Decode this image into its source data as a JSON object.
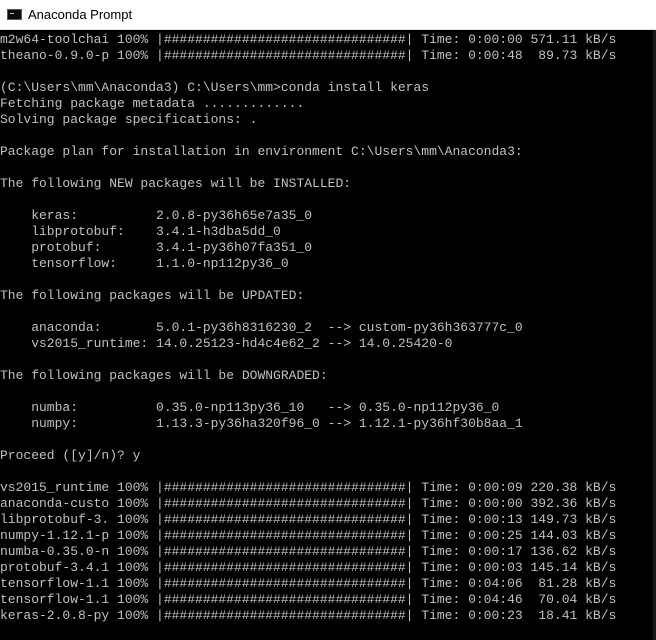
{
  "window": {
    "title": "Anaconda Prompt",
    "icon": "console-icon"
  },
  "console": {
    "lines": [
      "m2w64-toolchai 100% |###############################| Time: 0:00:00 571.11 kB/s",
      "theano-0.9.0-p 100% |###############################| Time: 0:00:48  89.73 kB/s",
      "",
      "(C:\\Users\\mm\\Anaconda3) C:\\Users\\mm>conda install keras",
      "Fetching package metadata .............",
      "Solving package specifications: .",
      "",
      "Package plan for installation in environment C:\\Users\\mm\\Anaconda3:",
      "",
      "The following NEW packages will be INSTALLED:",
      "",
      "    keras:          2.0.8-py36h65e7a35_0",
      "    libprotobuf:    3.4.1-h3dba5dd_0",
      "    protobuf:       3.4.1-py36h07fa351_0",
      "    tensorflow:     1.1.0-np112py36_0",
      "",
      "The following packages will be UPDATED:",
      "",
      "    anaconda:       5.0.1-py36h8316230_2  --> custom-py36h363777c_0",
      "    vs2015_runtime: 14.0.25123-hd4c4e62_2 --> 14.0.25420-0",
      "",
      "The following packages will be DOWNGRADED:",
      "",
      "    numba:          0.35.0-np113py36_10   --> 0.35.0-np112py36_0",
      "    numpy:          1.13.3-py36ha320f96_0 --> 1.12.1-py36hf30b8aa_1",
      "",
      "Proceed ([y]/n)? y",
      "",
      "vs2015_runtime 100% |###############################| Time: 0:00:09 220.38 kB/s",
      "anaconda-custo 100% |###############################| Time: 0:00:00 392.36 kB/s",
      "libprotobuf-3. 100% |###############################| Time: 0:00:13 149.73 kB/s",
      "numpy-1.12.1-p 100% |###############################| Time: 0:00:25 144.03 kB/s",
      "numba-0.35.0-n 100% |###############################| Time: 0:00:17 136.62 kB/s",
      "protobuf-3.4.1 100% |###############################| Time: 0:00:03 145.14 kB/s",
      "tensorflow-1.1 100% |###############################| Time: 0:04:06  81.28 kB/s",
      "tensorflow-1.1 100% |###############################| Time: 0:04:46  70.04 kB/s",
      "keras-2.0.8-py 100% |###############################| Time: 0:00:23  18.41 kB/s"
    ]
  }
}
